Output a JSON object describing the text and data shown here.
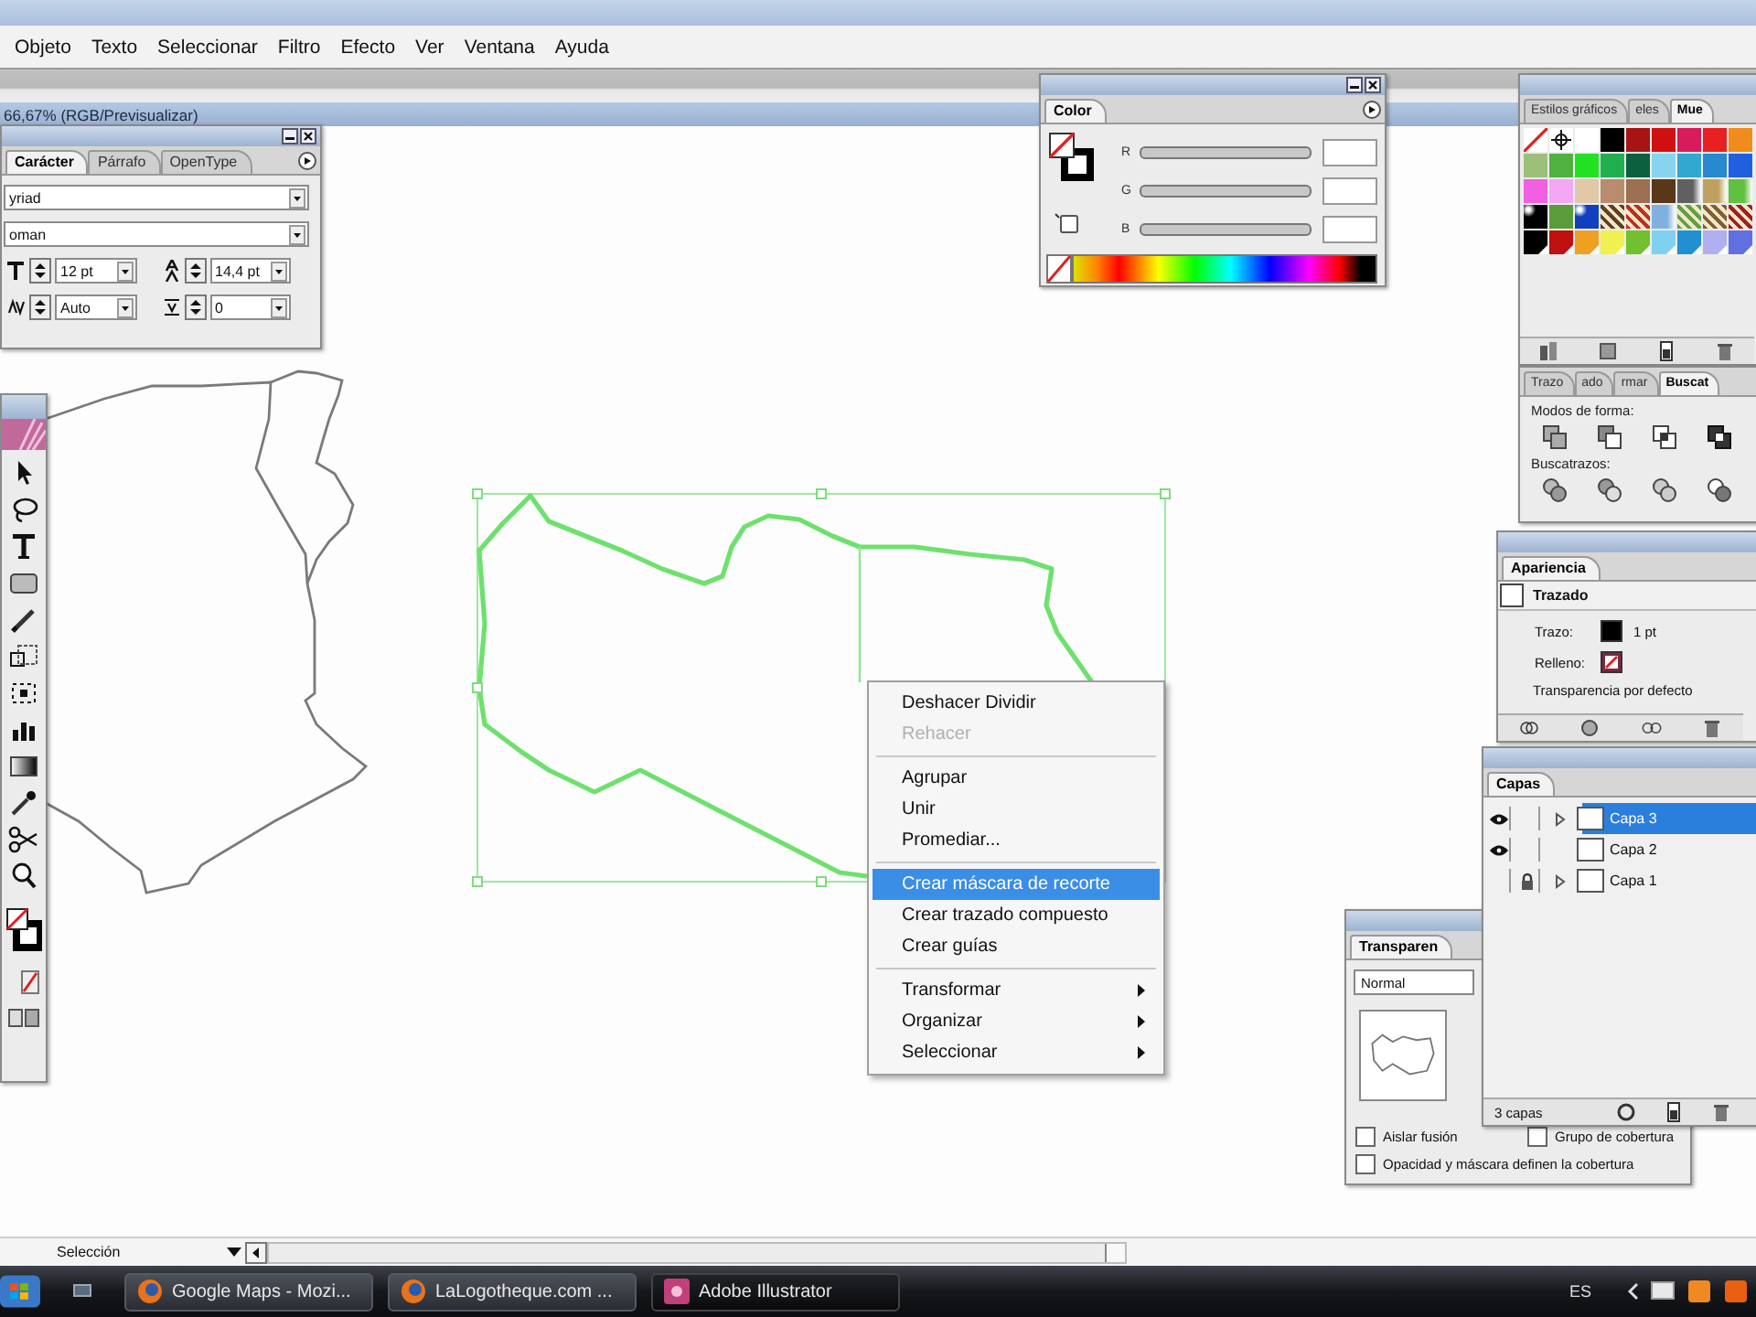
{
  "window": {
    "menu": [
      "Objeto",
      "Texto",
      "Seleccionar",
      "Filtro",
      "Efecto",
      "Ver",
      "Ventana",
      "Ayuda"
    ]
  },
  "document": {
    "title": "66,67% (RGB/Previsualizar)"
  },
  "character_panel": {
    "tabs": [
      {
        "label": "Carácter",
        "selected": true
      },
      {
        "label": "Párrafo",
        "selected": false
      },
      {
        "label": "OpenType",
        "selected": false
      }
    ],
    "font_family": "yriad",
    "font_style": "oman",
    "font_size": "12 pt",
    "leading": "14,4 pt",
    "kerning": "Auto",
    "tracking": "0"
  },
  "color_panel": {
    "tab": "Color",
    "channels": [
      {
        "label": "R"
      },
      {
        "label": "G"
      },
      {
        "label": "B"
      }
    ]
  },
  "swatches_panel": {
    "tabs": [
      {
        "label": "Estilos gráficos",
        "selected": false
      },
      {
        "label": "eles",
        "selected": false
      },
      {
        "label": "Mue",
        "selected": true
      }
    ],
    "swatches": [
      {
        "kind": "none"
      },
      {
        "kind": "registration"
      },
      {
        "kind": "solid",
        "color": "#ffffff"
      },
      {
        "kind": "solid",
        "color": "#000000"
      },
      {
        "kind": "solid",
        "color": "#a81414"
      },
      {
        "kind": "solid",
        "color": "#d01010"
      },
      {
        "kind": "solid",
        "color": "#d81b5a"
      },
      {
        "kind": "solid",
        "color": "#e82020"
      },
      {
        "kind": "solid",
        "color": "#f08c1c"
      },
      {
        "kind": "solid",
        "color": "#9cc07a"
      },
      {
        "kind": "solid",
        "color": "#50b040"
      },
      {
        "kind": "solid",
        "color": "#22e022"
      },
      {
        "kind": "solid",
        "color": "#20b050"
      },
      {
        "kind": "solid",
        "color": "#0c6040"
      },
      {
        "kind": "solid",
        "color": "#88d4f0"
      },
      {
        "kind": "solid",
        "color": "#30a8d0"
      },
      {
        "kind": "solid",
        "color": "#2888d0"
      },
      {
        "kind": "solid",
        "color": "#2060e0"
      },
      {
        "kind": "solid",
        "color": "#f060e0"
      },
      {
        "kind": "solid",
        "color": "#f4a8f4"
      },
      {
        "kind": "solid",
        "color": "#e0c8a8"
      },
      {
        "kind": "solid",
        "color": "#b88c6c"
      },
      {
        "kind": "solid",
        "color": "#9c7050"
      },
      {
        "kind": "solid",
        "color": "#583818"
      },
      {
        "kind": "gradient",
        "color": "#606060"
      },
      {
        "kind": "gradient",
        "color": "#c0a060"
      },
      {
        "kind": "gradient",
        "color": "#60c040"
      },
      {
        "kind": "radial",
        "color": "#000000"
      },
      {
        "kind": "solid",
        "color": "#5a9c3c"
      },
      {
        "kind": "radial",
        "color": "#1040c0"
      },
      {
        "kind": "pattern",
        "color": "#604020"
      },
      {
        "kind": "pattern",
        "color": "#c03020"
      },
      {
        "kind": "gradient",
        "color": "#80b0e0"
      },
      {
        "kind": "pattern",
        "color": "#60a040"
      },
      {
        "kind": "pattern",
        "color": "#806030"
      },
      {
        "kind": "pattern",
        "color": "#a02020"
      },
      {
        "kind": "spot",
        "color": "#000000"
      },
      {
        "kind": "spot",
        "color": "#c01010"
      },
      {
        "kind": "spot",
        "color": "#f0a020"
      },
      {
        "kind": "spot",
        "color": "#f0f050"
      },
      {
        "kind": "spot",
        "color": "#70c030"
      },
      {
        "kind": "spot",
        "color": "#80d0f0"
      },
      {
        "kind": "spot",
        "color": "#2090d0"
      },
      {
        "kind": "spot",
        "color": "#b0b0f0"
      },
      {
        "kind": "spot",
        "color": "#6070e0"
      }
    ]
  },
  "pathfinder_panel": {
    "tabs": [
      {
        "label": "Trazo",
        "selected": false
      },
      {
        "label": "ado",
        "selected": false
      },
      {
        "label": "rmar",
        "selected": false
      },
      {
        "label": "Buscat",
        "selected": true
      }
    ],
    "shape_modes_label": "Modos de forma:",
    "pathfinders_label": "Buscatrazos:"
  },
  "appearance_panel": {
    "tab": "Apariencia",
    "item": "Trazado",
    "rows": [
      {
        "kind": "stroke",
        "label": "Trazo:",
        "value": "1 pt"
      },
      {
        "kind": "fill",
        "label": "Relleno:"
      }
    ],
    "footer": "Transparencia por defecto"
  },
  "context_menu": {
    "groups": [
      [
        {
          "label": "Deshacer Dividir",
          "disabled": false,
          "selected": false,
          "submenu": false
        },
        {
          "label": "Rehacer",
          "disabled": true,
          "selected": false,
          "submenu": false
        }
      ],
      [
        {
          "label": "Agrupar",
          "disabled": false,
          "selected": false,
          "submenu": false
        },
        {
          "label": "Unir",
          "disabled": false,
          "selected": false,
          "submenu": false
        },
        {
          "label": "Promediar...",
          "disabled": false,
          "selected": false,
          "submenu": false
        }
      ],
      [
        {
          "label": "Crear máscara de recorte",
          "disabled": false,
          "selected": true,
          "submenu": false
        },
        {
          "label": "Crear trazado compuesto",
          "disabled": false,
          "selected": false,
          "submenu": false
        },
        {
          "label": "Crear guías",
          "disabled": false,
          "selected": false,
          "submenu": false
        }
      ],
      [
        {
          "label": "Transformar",
          "disabled": false,
          "selected": false,
          "submenu": true
        },
        {
          "label": "Organizar",
          "disabled": false,
          "selected": false,
          "submenu": true
        },
        {
          "label": "Seleccionar",
          "disabled": false,
          "selected": false,
          "submenu": true
        }
      ]
    ]
  },
  "transparency_panel": {
    "tab": "Transparen",
    "blend_mode": "Normal",
    "options": [
      {
        "label": "Aislar fusión",
        "checked": false
      },
      {
        "label": "Grupo de cobertura",
        "checked": false
      },
      {
        "label": "Opacidad y máscara definen la cobertura",
        "checked": false
      }
    ]
  },
  "layers_panel": {
    "tab": "Capas",
    "layers": [
      {
        "name": "Capa 3",
        "visible": true,
        "locked": false,
        "expandable": true,
        "selected": true
      },
      {
        "name": "Capa 2",
        "visible": true,
        "locked": false,
        "expandable": false,
        "selected": false
      },
      {
        "name": "Capa 1",
        "visible": false,
        "locked": true,
        "expandable": true,
        "selected": false
      }
    ],
    "count": "3 capas"
  },
  "status_bar": {
    "tool": "Selección"
  },
  "taskbar": {
    "buttons": [
      {
        "label": "Google Maps - Mozi...",
        "kind": "browser",
        "selected": false
      },
      {
        "label": "LaLogotheque.com ...",
        "kind": "browser",
        "selected": false
      },
      {
        "label": "Adobe Illustrator",
        "kind": "illustrator",
        "selected": true
      }
    ],
    "language": "ES"
  }
}
